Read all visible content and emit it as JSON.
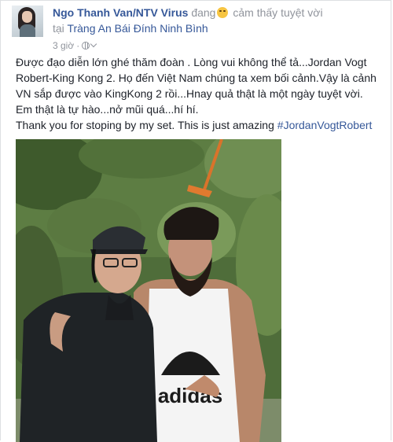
{
  "post": {
    "author": "Ngo Thanh Van/NTV Virus",
    "verb": "đang",
    "feeling_emoji": "smiling-face-icon",
    "feeling": "cảm thấy tuyệt vời",
    "location_prefix": "tại",
    "location": "Tràng An Bái Đính Ninh Bình",
    "time": "3 giờ",
    "time_separator": "·",
    "privacy_icon": "globe-icon",
    "body_lines": [
      "Được đạo diễn lớn ghé thăm đoàn . Lòng vui không thể tả...Jordan Vogt",
      "Robert-King Kong 2. Họ đến Việt Nam chúng ta xem bối cảnh.Vậy là cảnh",
      "VN sắp được vào KingKong 2 rồi...Hnay quả thật là một ngày tuyệt vời.",
      "Em thật là tự hào...nở mũi quá...hí hí."
    ],
    "english_line": "Thank you for stoping by my set. This is just amazing ",
    "hashtag": "#JordanVogtRobert",
    "photo_shirt_text": "adidas"
  },
  "colors": {
    "link": "#365899",
    "muted": "#90949c",
    "text": "#1d2129",
    "border": "#dddfe2"
  }
}
